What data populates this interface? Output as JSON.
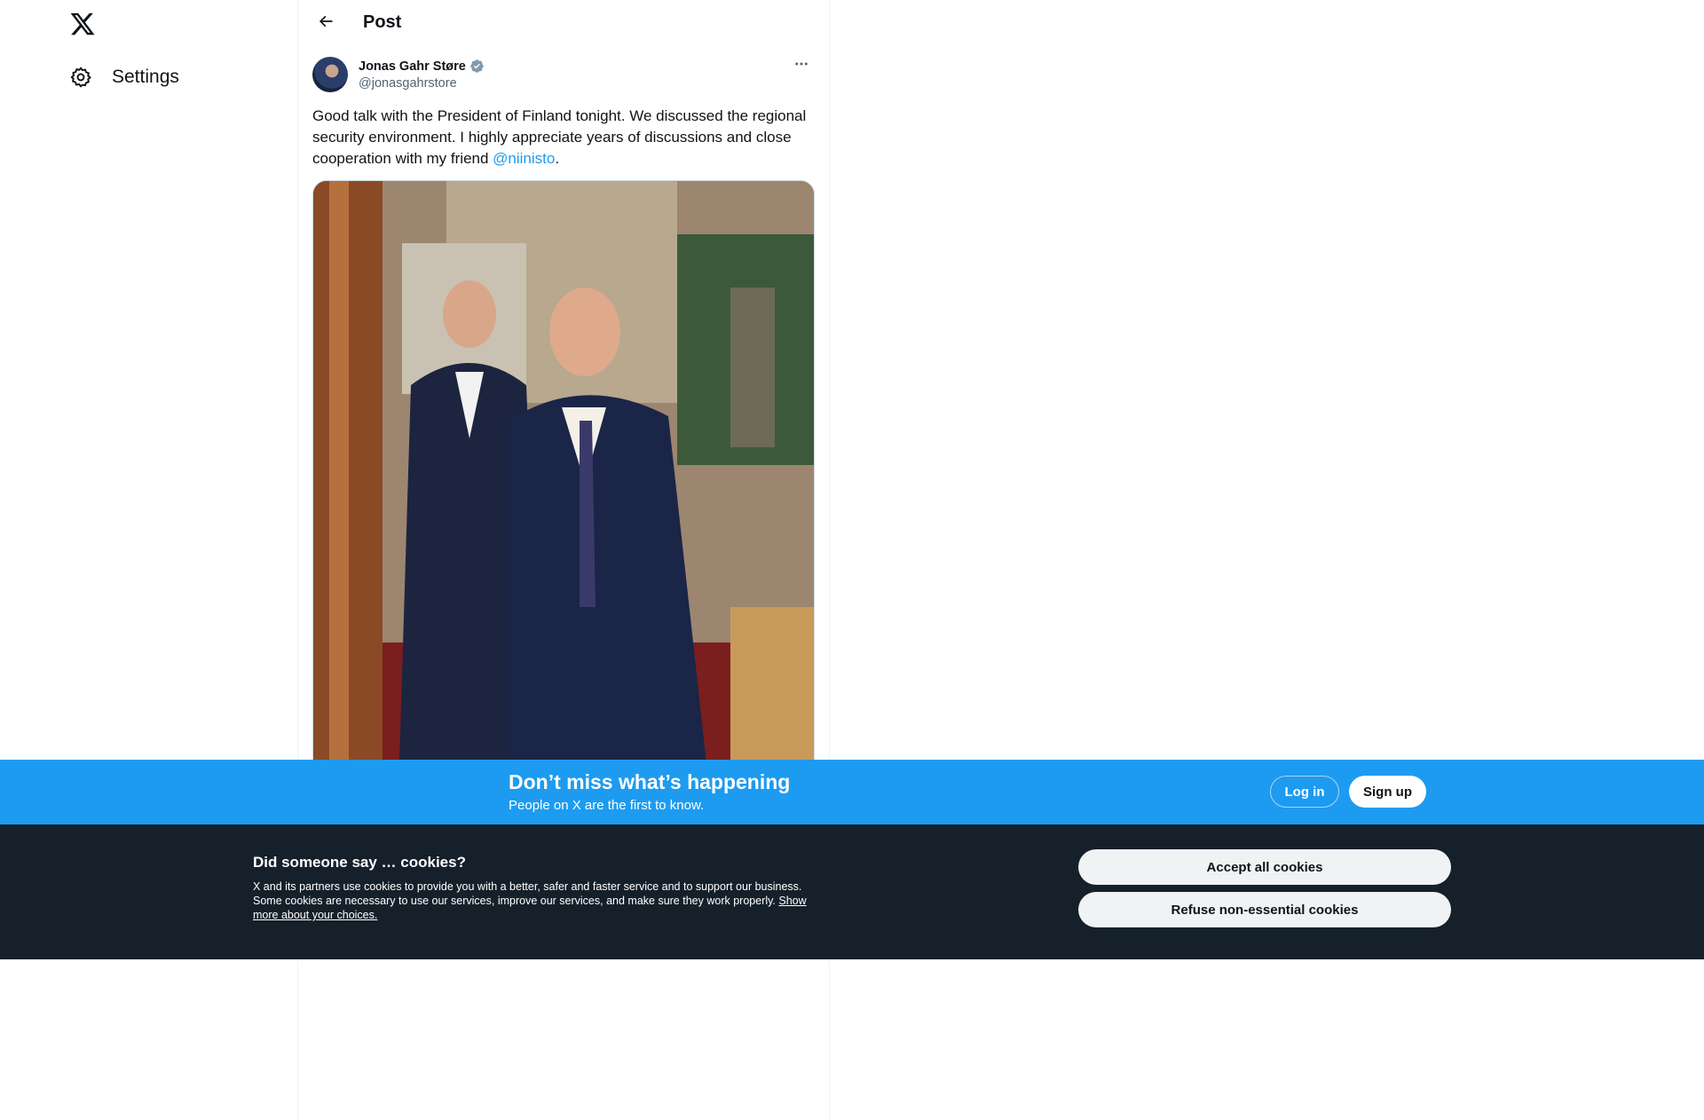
{
  "nav": {
    "logo_icon": "x-logo-icon",
    "settings_label": "Settings",
    "settings_icon": "gear-icon"
  },
  "header": {
    "title": "Post",
    "back_icon": "arrow-left-icon"
  },
  "tweet": {
    "author_name": "Jonas Gahr Støre",
    "author_handle": "@jonasgahrstore",
    "verified_icon": "verified-badge-icon",
    "more_icon": "more-horizontal-icon",
    "text_before": "Good talk with the President of Finland tonight. We discussed the regional security environment. I highly appreciate years of discussions and close cooperation with my friend ",
    "mention": "@niinisto",
    "text_after": "."
  },
  "login_banner": {
    "title": "Don’t miss what’s happening",
    "subtitle": "People on X are the first to know.",
    "login_label": "Log in",
    "signup_label": "Sign up",
    "background_color": "#1d9bf0"
  },
  "cookie_banner": {
    "title": "Did someone say … cookies?",
    "text": "X and its partners use cookies to provide you with a better, safer and faster service and to support our business. Some cookies are necessary to use our services, improve our services, and make sure they work properly. ",
    "link": "Show more about your choices.",
    "accept_label": "Accept all cookies",
    "refuse_label": "Refuse non-essential cookies",
    "background_color": "#15202b"
  }
}
